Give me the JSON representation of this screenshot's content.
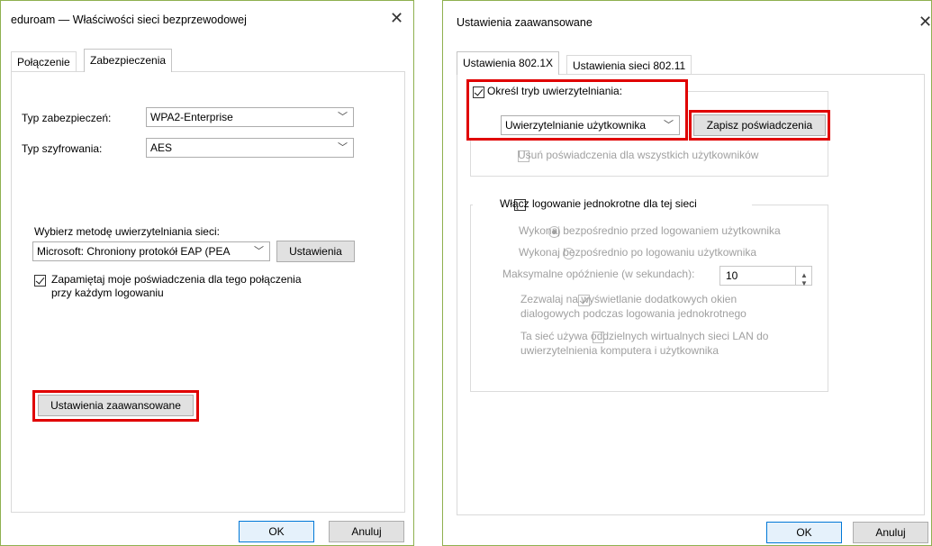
{
  "left_dialog": {
    "title": "eduroam — Właściwości sieci bezprzewodowej",
    "close_glyph": "✕",
    "tabs": [
      {
        "label": "Połączenie",
        "active": false
      },
      {
        "label": "Zabezpieczenia",
        "active": true
      }
    ],
    "security_type_label": "Typ zabezpieczeń:",
    "security_type_value": "WPA2-Enterprise",
    "encryption_type_label": "Typ szyfrowania:",
    "encryption_type_value": "AES",
    "auth_method_label": "Wybierz metodę uwierzytelniania sieci:",
    "auth_method_value": "Microsoft: Chroniony protokół EAP (PEA",
    "settings_button": "Ustawienia",
    "remember_checkbox": {
      "label_line1": "Zapamiętaj moje poświadczenia dla tego połączenia",
      "label_line2": "przy każdym logowaniu",
      "checked": true
    },
    "advanced_button": "Ustawienia zaawansowane",
    "ok_button": "OK",
    "cancel_button": "Anuluj"
  },
  "right_dialog": {
    "title": "Ustawienia zaawansowane",
    "close_glyph": "✕",
    "tabs": [
      {
        "label": "Ustawienia 802.1X",
        "active": true
      },
      {
        "label": "Ustawienia sieci 802.11",
        "active": false
      }
    ],
    "specify_auth_mode": {
      "label": "Określ tryb uwierzytelniania:",
      "checked": true
    },
    "auth_mode_value": "Uwierzytelnianie użytkownika",
    "save_credentials_button": "Zapisz poświadczenia",
    "delete_credentials": {
      "label": "Usuń poświadczenia dla wszystkich użytkowników",
      "checked": false
    },
    "sso_enable": {
      "label": "Włącz logowanie jednokrotne dla tej sieci",
      "checked": false
    },
    "sso_before": {
      "label": "Wykonaj bezpośrednio przed logowaniem użytkownika",
      "selected": true
    },
    "sso_after": {
      "label": "Wykonaj bezpośrednio po logowaniu użytkownika",
      "selected": false
    },
    "max_delay_label": "Maksymalne opóźnienie (w sekundach):",
    "max_delay_value": "10",
    "allow_dialogs": {
      "label_line1": "Zezwalaj na wyświetlanie dodatkowych okien",
      "label_line2": "dialogowych podczas logowania jednokrotnego",
      "checked": true
    },
    "vlan": {
      "label_line1": "Ta sieć używa oddzielnych wirtualnych sieci LAN do",
      "label_line2": "uwierzytelnienia komputera i użytkownika",
      "checked": false
    },
    "ok_button": "OK",
    "cancel_button": "Anuluj"
  },
  "colors": {
    "highlight": "#e00000",
    "window_border": "#8fb04f",
    "disabled_text": "#a0a0a0",
    "default_button_border": "#0078d7"
  }
}
